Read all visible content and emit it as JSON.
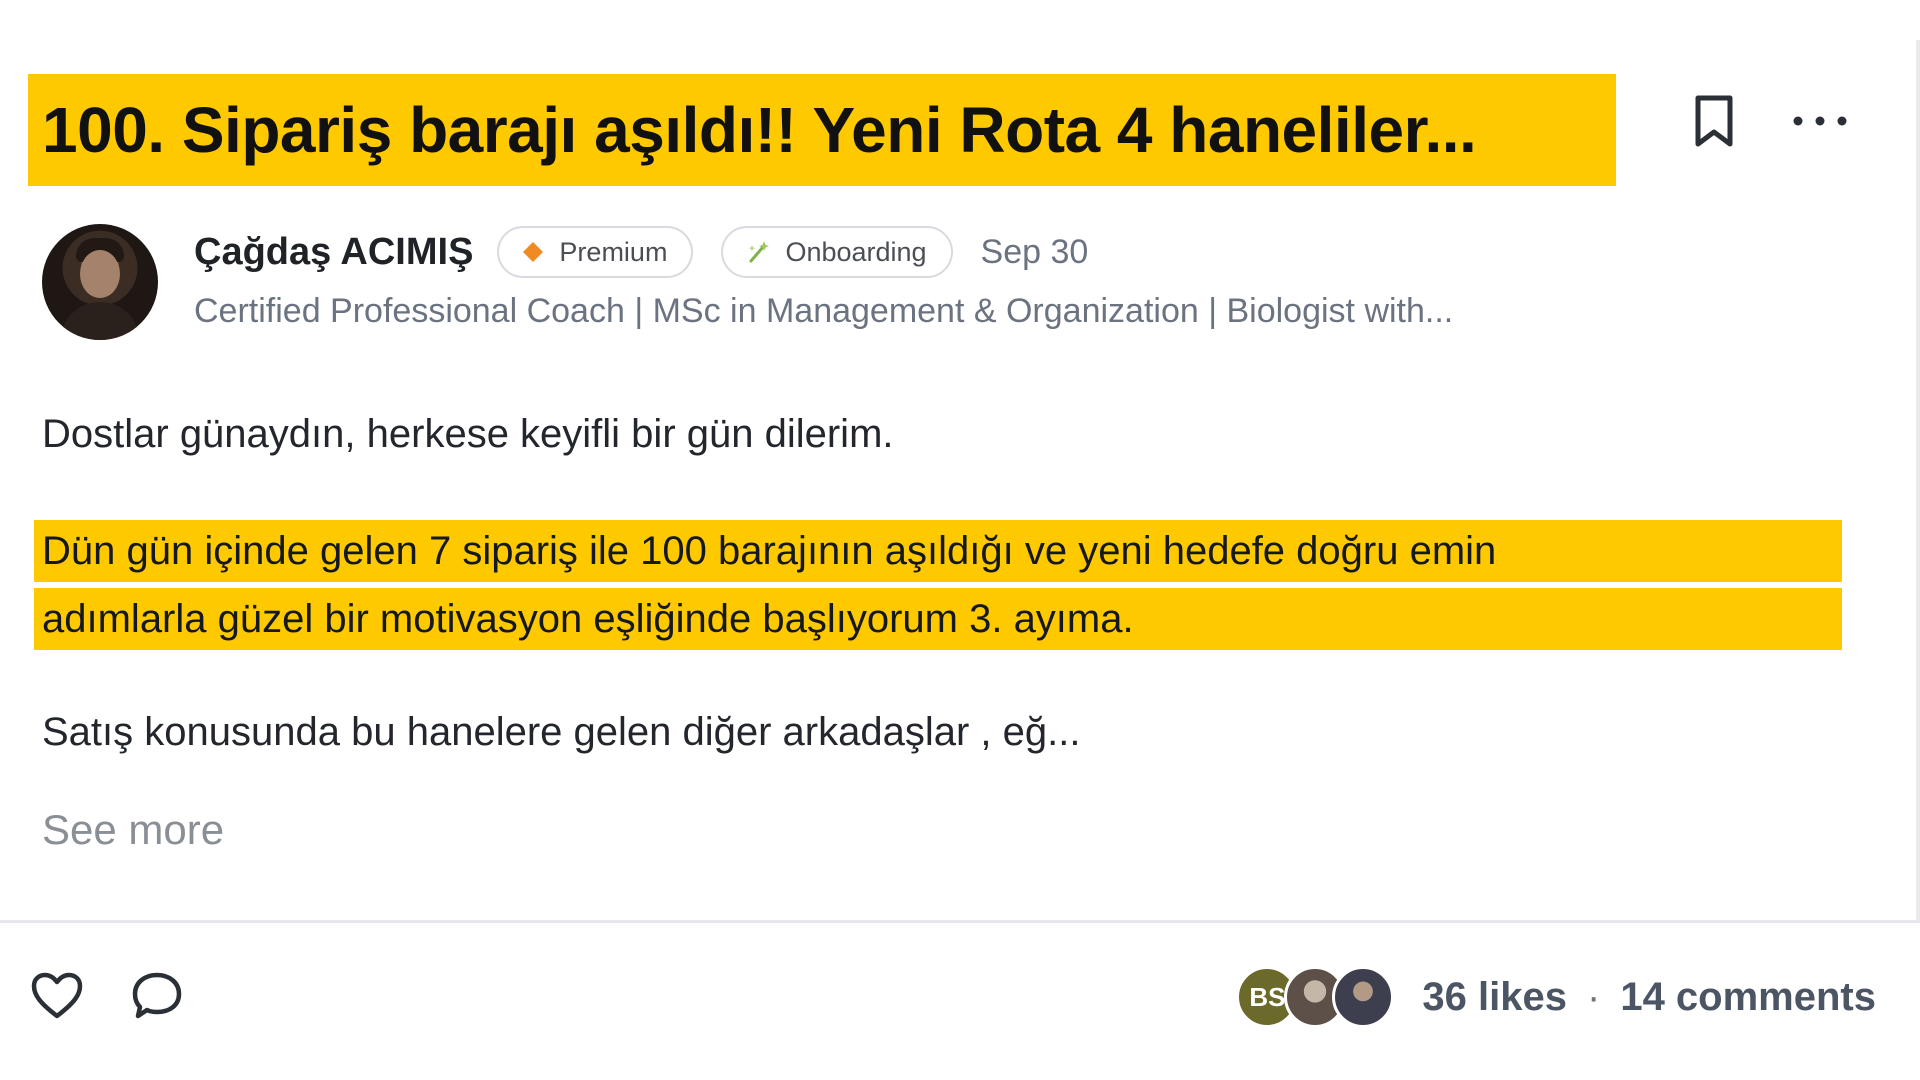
{
  "post": {
    "title": "100. Sipariş barajı aşıldı!! Yeni Rota 4 haneliler...",
    "author": {
      "name": "Çağdaş ACIMIŞ",
      "badges": [
        {
          "label": "Premium",
          "icon": "diamond-icon",
          "color": "#f08a24"
        },
        {
          "label": "Onboarding",
          "icon": "sparkle-icon",
          "color": "#7fb24a"
        }
      ],
      "date": "Sep 30",
      "headline": "Certified Professional Coach | MSc in Management & Organization | Biologist with..."
    },
    "body": {
      "p1": "Dostlar günaydın, herkese keyifli bir gün dilerim.",
      "highlight_lines": [
        "Dün gün içinde gelen 7 sipariş ile 100 barajının aşıldığı ve yeni hedefe doğru emin",
        "adımlarla güzel bir motivasyon eşliğinde başlıyorum 3. ayıma."
      ],
      "p3": "Satış konusunda bu hanelere gelen diğer arkadaşlar , eğ..."
    },
    "see_more": "See more",
    "footer": {
      "liker_initials": "BS",
      "likes": "36 likes",
      "separator": "·",
      "comments": "14 comments"
    },
    "colors": {
      "highlight": "#ffc900",
      "muted_text": "#6b7280"
    }
  }
}
